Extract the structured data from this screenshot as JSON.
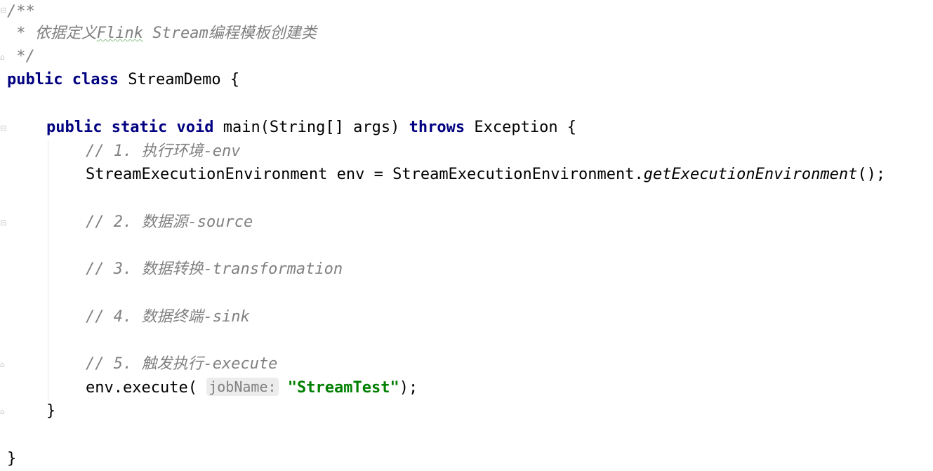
{
  "editor": {
    "lines": {
      "doc_open": "/**",
      "doc_body_prefix": " * 依据定义",
      "doc_body_flink": "Flink",
      "doc_body_rest": " Stream编程模板创建类",
      "doc_close": " */",
      "class_kw_public": "public",
      "class_kw_class": "class",
      "class_name": "StreamDemo {",
      "main_kw_public": "public",
      "main_kw_static": "static",
      "main_kw_void": "void",
      "main_sig": "main(String[] args)",
      "main_kw_throws": "throws",
      "main_exception": "Exception {",
      "c1": "// 1. 执行环境-env",
      "env_decl": "StreamExecutionEnvironment env = StreamExecutionEnvironment.",
      "env_method": "getExecutionEnvironment",
      "env_end": "();",
      "c2": "// 2. 数据源-source",
      "c3": "// 3. 数据转换-transformation",
      "c4": "// 4. 数据终端-sink",
      "c5": "// 5. 触发执行-execute",
      "exec_prefix": "env.execute(",
      "exec_hint": "jobName:",
      "exec_string": "\"StreamTest\"",
      "exec_end": ");",
      "main_close": "}",
      "class_close": "}"
    },
    "colors": {
      "keyword": "#000080",
      "comment": "#808080",
      "string": "#008000",
      "hint_bg": "#ececec"
    }
  }
}
